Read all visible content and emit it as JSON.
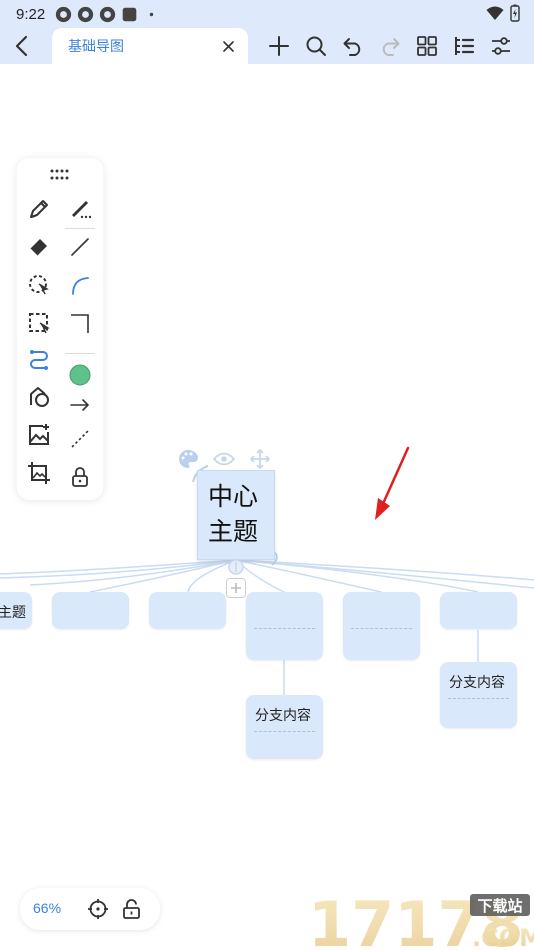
{
  "status_bar": {
    "time": "9:22",
    "battery_icon": "battery-icon",
    "wifi_icon": "wifi-icon"
  },
  "top_bar": {
    "back_icon": "chevron-left-icon",
    "tab_title": "基础导图",
    "close_icon": "close-icon",
    "toolbar": [
      "plus-icon",
      "search-icon",
      "undo-icon",
      "redo-icon",
      "grid-icon",
      "outline-icon",
      "settings-sliders-icon"
    ]
  },
  "palette": {
    "tools": [
      "pen-icon",
      "marker-icon",
      "eraser-icon",
      "line-icon",
      "lasso-select-icon",
      "curve-icon",
      "rect-select-icon",
      "corner-line-icon",
      "connector-icon",
      "fill-circle-icon",
      "shape-icon",
      "arrow-icon",
      "image-add-icon",
      "dashed-line-icon",
      "image-frame-icon",
      "lock-icon"
    ]
  },
  "mindmap": {
    "center_topic": [
      "中心",
      "主题"
    ],
    "partial_topic": "主题",
    "branch_content_1": "分支内容",
    "branch_content_2": "分支内容"
  },
  "bottom": {
    "zoom": "66%"
  },
  "watermark": {
    "digits": "17178",
    "tag": "下载站",
    "domain": ".COM"
  },
  "colors": {
    "accent": "#3b82e0",
    "node_fill": "#d9e8fa",
    "header_bg": "#deeafb",
    "arrow_red": "#e02020",
    "green": "#5ec28a"
  }
}
